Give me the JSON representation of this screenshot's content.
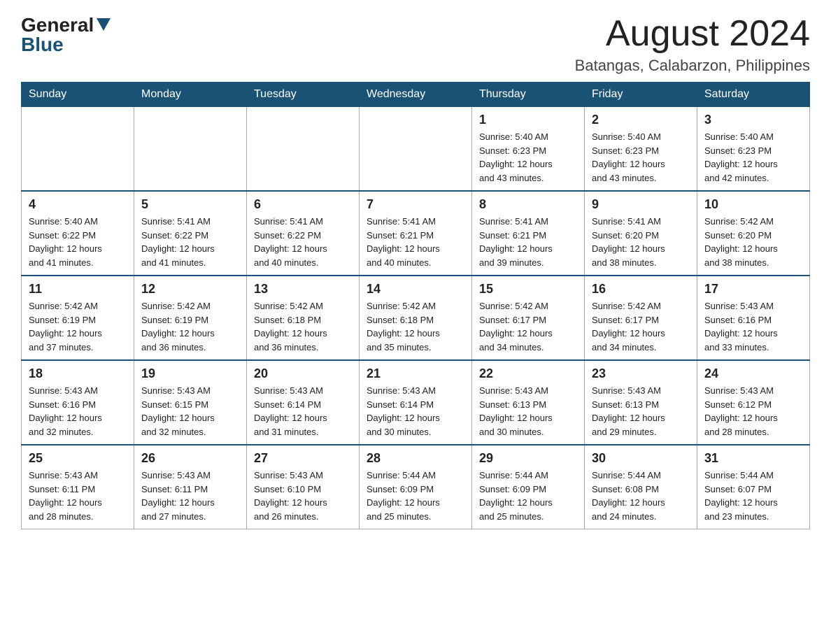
{
  "header": {
    "logo_general": "General",
    "logo_blue": "Blue",
    "month_title": "August 2024",
    "location": "Batangas, Calabarzon, Philippines"
  },
  "days_of_week": [
    "Sunday",
    "Monday",
    "Tuesday",
    "Wednesday",
    "Thursday",
    "Friday",
    "Saturday"
  ],
  "weeks": [
    [
      {
        "day": "",
        "info": ""
      },
      {
        "day": "",
        "info": ""
      },
      {
        "day": "",
        "info": ""
      },
      {
        "day": "",
        "info": ""
      },
      {
        "day": "1",
        "info": "Sunrise: 5:40 AM\nSunset: 6:23 PM\nDaylight: 12 hours\nand 43 minutes."
      },
      {
        "day": "2",
        "info": "Sunrise: 5:40 AM\nSunset: 6:23 PM\nDaylight: 12 hours\nand 43 minutes."
      },
      {
        "day": "3",
        "info": "Sunrise: 5:40 AM\nSunset: 6:23 PM\nDaylight: 12 hours\nand 42 minutes."
      }
    ],
    [
      {
        "day": "4",
        "info": "Sunrise: 5:40 AM\nSunset: 6:22 PM\nDaylight: 12 hours\nand 41 minutes."
      },
      {
        "day": "5",
        "info": "Sunrise: 5:41 AM\nSunset: 6:22 PM\nDaylight: 12 hours\nand 41 minutes."
      },
      {
        "day": "6",
        "info": "Sunrise: 5:41 AM\nSunset: 6:22 PM\nDaylight: 12 hours\nand 40 minutes."
      },
      {
        "day": "7",
        "info": "Sunrise: 5:41 AM\nSunset: 6:21 PM\nDaylight: 12 hours\nand 40 minutes."
      },
      {
        "day": "8",
        "info": "Sunrise: 5:41 AM\nSunset: 6:21 PM\nDaylight: 12 hours\nand 39 minutes."
      },
      {
        "day": "9",
        "info": "Sunrise: 5:41 AM\nSunset: 6:20 PM\nDaylight: 12 hours\nand 38 minutes."
      },
      {
        "day": "10",
        "info": "Sunrise: 5:42 AM\nSunset: 6:20 PM\nDaylight: 12 hours\nand 38 minutes."
      }
    ],
    [
      {
        "day": "11",
        "info": "Sunrise: 5:42 AM\nSunset: 6:19 PM\nDaylight: 12 hours\nand 37 minutes."
      },
      {
        "day": "12",
        "info": "Sunrise: 5:42 AM\nSunset: 6:19 PM\nDaylight: 12 hours\nand 36 minutes."
      },
      {
        "day": "13",
        "info": "Sunrise: 5:42 AM\nSunset: 6:18 PM\nDaylight: 12 hours\nand 36 minutes."
      },
      {
        "day": "14",
        "info": "Sunrise: 5:42 AM\nSunset: 6:18 PM\nDaylight: 12 hours\nand 35 minutes."
      },
      {
        "day": "15",
        "info": "Sunrise: 5:42 AM\nSunset: 6:17 PM\nDaylight: 12 hours\nand 34 minutes."
      },
      {
        "day": "16",
        "info": "Sunrise: 5:42 AM\nSunset: 6:17 PM\nDaylight: 12 hours\nand 34 minutes."
      },
      {
        "day": "17",
        "info": "Sunrise: 5:43 AM\nSunset: 6:16 PM\nDaylight: 12 hours\nand 33 minutes."
      }
    ],
    [
      {
        "day": "18",
        "info": "Sunrise: 5:43 AM\nSunset: 6:16 PM\nDaylight: 12 hours\nand 32 minutes."
      },
      {
        "day": "19",
        "info": "Sunrise: 5:43 AM\nSunset: 6:15 PM\nDaylight: 12 hours\nand 32 minutes."
      },
      {
        "day": "20",
        "info": "Sunrise: 5:43 AM\nSunset: 6:14 PM\nDaylight: 12 hours\nand 31 minutes."
      },
      {
        "day": "21",
        "info": "Sunrise: 5:43 AM\nSunset: 6:14 PM\nDaylight: 12 hours\nand 30 minutes."
      },
      {
        "day": "22",
        "info": "Sunrise: 5:43 AM\nSunset: 6:13 PM\nDaylight: 12 hours\nand 30 minutes."
      },
      {
        "day": "23",
        "info": "Sunrise: 5:43 AM\nSunset: 6:13 PM\nDaylight: 12 hours\nand 29 minutes."
      },
      {
        "day": "24",
        "info": "Sunrise: 5:43 AM\nSunset: 6:12 PM\nDaylight: 12 hours\nand 28 minutes."
      }
    ],
    [
      {
        "day": "25",
        "info": "Sunrise: 5:43 AM\nSunset: 6:11 PM\nDaylight: 12 hours\nand 28 minutes."
      },
      {
        "day": "26",
        "info": "Sunrise: 5:43 AM\nSunset: 6:11 PM\nDaylight: 12 hours\nand 27 minutes."
      },
      {
        "day": "27",
        "info": "Sunrise: 5:43 AM\nSunset: 6:10 PM\nDaylight: 12 hours\nand 26 minutes."
      },
      {
        "day": "28",
        "info": "Sunrise: 5:44 AM\nSunset: 6:09 PM\nDaylight: 12 hours\nand 25 minutes."
      },
      {
        "day": "29",
        "info": "Sunrise: 5:44 AM\nSunset: 6:09 PM\nDaylight: 12 hours\nand 25 minutes."
      },
      {
        "day": "30",
        "info": "Sunrise: 5:44 AM\nSunset: 6:08 PM\nDaylight: 12 hours\nand 24 minutes."
      },
      {
        "day": "31",
        "info": "Sunrise: 5:44 AM\nSunset: 6:07 PM\nDaylight: 12 hours\nand 23 minutes."
      }
    ]
  ]
}
